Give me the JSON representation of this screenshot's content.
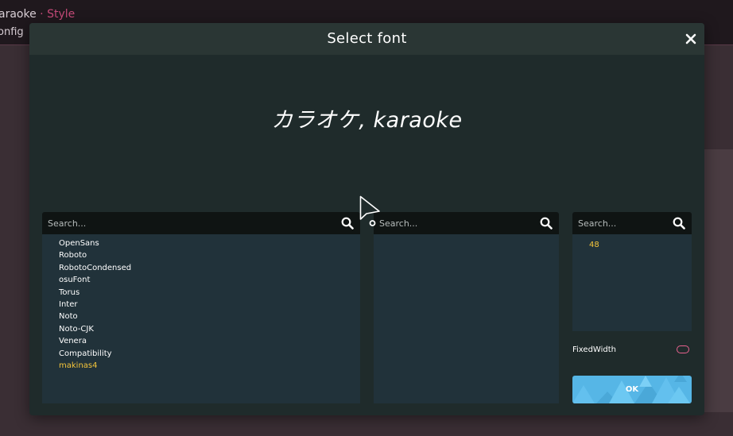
{
  "background": {
    "app_title": "araoke",
    "app_title_separator": "·",
    "app_title_section": "Style",
    "sub_label": "onfig"
  },
  "dialog": {
    "title": "Select font",
    "close_icon": "close-icon",
    "preview_text": "カラオケ, karaoke"
  },
  "family_panel": {
    "search_placeholder": "Search...",
    "search_icon": "search-icon",
    "items": [
      {
        "label": "OpenSans",
        "selected": false
      },
      {
        "label": "Roboto",
        "selected": false
      },
      {
        "label": "RobotoCondensed",
        "selected": false
      },
      {
        "label": "osuFont",
        "selected": false
      },
      {
        "label": "Torus",
        "selected": false
      },
      {
        "label": "Inter",
        "selected": false
      },
      {
        "label": "Noto",
        "selected": false
      },
      {
        "label": "Noto-CJK",
        "selected": false
      },
      {
        "label": "Venera",
        "selected": false
      },
      {
        "label": "Compatibility",
        "selected": false
      },
      {
        "label": "makinas4",
        "selected": true
      }
    ]
  },
  "style_panel": {
    "search_placeholder": "Search...",
    "search_icon": "search-icon",
    "items": []
  },
  "size_panel": {
    "search_placeholder": "Search...",
    "search_icon": "search-icon",
    "items": [
      "48"
    ],
    "selected": "48"
  },
  "fixed_width": {
    "label": "FixedWidth",
    "enabled": false
  },
  "ok_button": {
    "label": "OK"
  },
  "colors": {
    "accent_selected": "#f5c53a",
    "toggle_border": "#e8628f",
    "ok_button": "#56b6e6",
    "dialog_bg": "#1f2b2b",
    "list_bg": "#21323a"
  }
}
